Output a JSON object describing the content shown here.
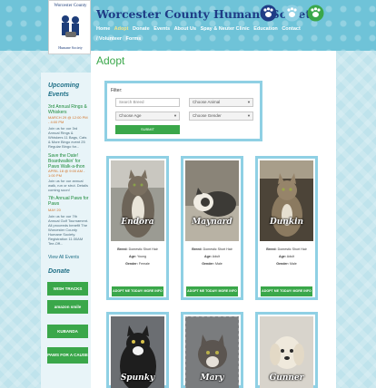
{
  "site": {
    "title": "Worcester County Humane Society",
    "logo_arc": "Worcester County",
    "logo_sub": "Humane Society"
  },
  "nav": [
    {
      "label": "Home",
      "active": false
    },
    {
      "label": "Adopt",
      "active": true
    },
    {
      "label": "Donate",
      "active": false
    },
    {
      "label": "Events",
      "active": false
    },
    {
      "label": "About Us",
      "active": false
    },
    {
      "label": "Spay & Neuter Clinic",
      "active": false
    },
    {
      "label": "Education",
      "active": false
    },
    {
      "label": "Contact / Volunteer",
      "active": false
    },
    {
      "label": "Forms",
      "active": false
    }
  ],
  "header_icons": [
    {
      "name": "paw-icon-blue",
      "color": "#1f3c86"
    },
    {
      "name": "paw-icon-light",
      "color": "#8fd0e4"
    },
    {
      "name": "paw-icon-green",
      "color": "#3aa74a"
    }
  ],
  "sidebar": {
    "events_title": "Upcoming Events",
    "events": [
      {
        "title": "3rd Annual Rings & Whiskers",
        "date": "MARCH 29 @ 12:00 PM - 4:00 PM",
        "text": "Join us for our 3rd Annual Rings & Whiskers 11 Bags, Cats & More Bingo event 25 Regular Bingo for..."
      },
      {
        "title": "Save the Date! Boardwalkin' for Paws Walk-a-thon",
        "date": "APRIL 18 @ 9:00 AM - 1:00 PM",
        "text": "Join us for our annual walk, run or strut. Details coming soon!"
      },
      {
        "title": "7th Annual Paws for Paws",
        "date": "MAY 20",
        "text": "Join us for our 7th Annual Golf Tournament. All proceeds benefit The Worcester County Humane Society. Registration 11:30AM Tee-Off..."
      }
    ],
    "view_all": "View All Events",
    "donate_title": "Donate",
    "donate_buttons": [
      {
        "label": "WISH TRACKS",
        "color": "#3aa74a"
      },
      {
        "label": "amazon smile",
        "color": "#3aa74a"
      },
      {
        "label": "KUBANDA",
        "color": "#3aa74a"
      },
      {
        "label": "PAWS FOR A CAUSE",
        "color": "#3aa74a"
      }
    ]
  },
  "page_title": "Adopt",
  "filter": {
    "label": "Filter:",
    "search_placeholder": "Search Breed",
    "animal_select": "Choose Animal",
    "age_select": "Choose Age",
    "gender_select": "Choose Gender",
    "submit": "SUBMIT"
  },
  "pets": [
    {
      "name": "Endora",
      "breed": "Domestic Short Hair",
      "age": "Young",
      "gender": "Female",
      "adopt": "ADOPT ME TODAY! MORE INFO"
    },
    {
      "name": "Maynard",
      "breed": "Domestic Short Hair",
      "age": "Adult",
      "gender": "Male",
      "adopt": "ADOPT ME TODAY! MORE INFO"
    },
    {
      "name": "Dunkin",
      "breed": "Domestic Short Hair",
      "age": "Adult",
      "gender": "Male",
      "adopt": "ADOPT ME TODAY! MORE INFO"
    },
    {
      "name": "Spunky"
    },
    {
      "name": "Mary"
    },
    {
      "name": "Gunner"
    }
  ],
  "labels": {
    "breed": "Breed:",
    "age": "Age:",
    "gender": "Gender:"
  }
}
